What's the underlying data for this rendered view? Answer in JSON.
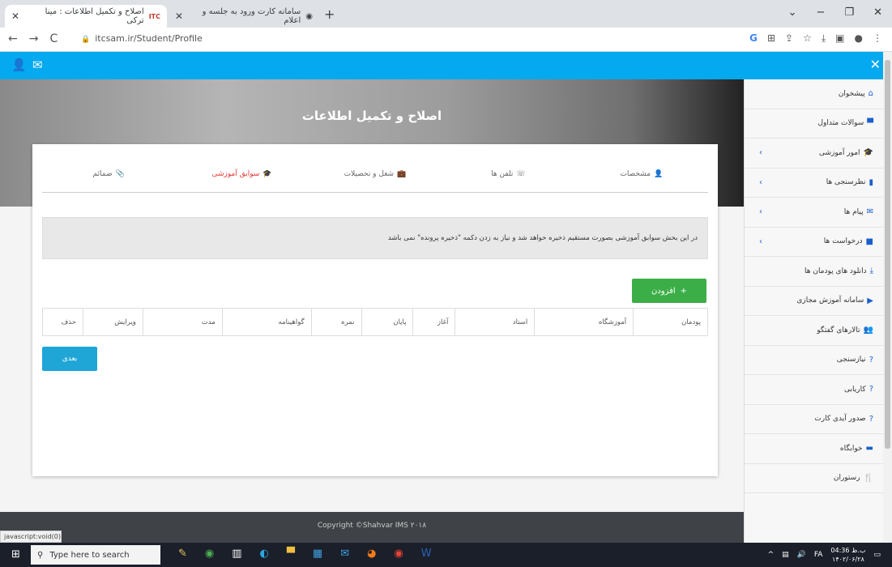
{
  "browser": {
    "tabs": [
      {
        "title": "اصلاح و تکمیل اطلاعات : مینا ترکی",
        "favicon": "ITC"
      },
      {
        "title": "سامانه کارت ورود به جلسه و اعلام"
      }
    ],
    "url": "itcsam.ir/Student/Profile"
  },
  "hero": {
    "title": "اصلاح و تکمیل اطلاعات"
  },
  "steps": [
    {
      "label": "مشخصات",
      "icon": "user-icon"
    },
    {
      "label": "تلفن ها",
      "icon": "phone-icon"
    },
    {
      "label": "شغل و تحصیلات",
      "icon": "briefcase-icon"
    },
    {
      "label": "سوابق آموزشی",
      "icon": "graduation-cap-icon",
      "active": true
    },
    {
      "label": "ضمائم",
      "icon": "paperclip-icon"
    }
  ],
  "notice": "در این بخش سوابق آموزشی بصورت مستقیم ذخیره خواهد شد و نیاز به زدن دکمه \"ذخیره پرونده\" نمی باشد",
  "add_button": "افزودن",
  "table_headers": [
    "پودمان",
    "آموزشگاه",
    "استاد",
    "آغاز",
    "پایان",
    "نمره",
    "گواهینامه",
    "مدت",
    "ویرایش",
    "حذف"
  ],
  "next_button": "بعدی",
  "footer": "Copyright ©Shahvar IMS ۲۰۱۸",
  "sidebar": [
    {
      "label": "پیشخوان",
      "icon": "home-icon"
    },
    {
      "label": "سوالات متداول",
      "icon": "chat-icon"
    },
    {
      "label": "امور آموزشی",
      "icon": "graduation-cap-icon",
      "chevron": true
    },
    {
      "label": "نظرسنجی ها",
      "icon": "bar-chart-icon",
      "chevron": true
    },
    {
      "label": "پیام ها",
      "icon": "envelope-icon",
      "chevron": true
    },
    {
      "label": "درخواست ها",
      "icon": "comment-icon",
      "chevron": true
    },
    {
      "label": "دانلود های پودمان ها",
      "icon": "download-icon"
    },
    {
      "label": "سامانه آموزش مجازی",
      "icon": "play-circle-icon"
    },
    {
      "label": "تالارهای گفتگو",
      "icon": "users-icon"
    },
    {
      "label": "نیازسنجی",
      "icon": "question-circle-icon"
    },
    {
      "label": "کاریابی",
      "icon": "question-circle-icon"
    },
    {
      "label": "صدور آیدی کارت",
      "icon": "question-circle-icon"
    },
    {
      "label": "خوابگاه",
      "icon": "bed-icon"
    },
    {
      "label": "رستوران",
      "icon": "utensils-icon"
    }
  ],
  "statusbar": "javascript:void(0)",
  "taskbar": {
    "search_placeholder": "Type here to search",
    "time": "04:36 ب.ظ",
    "date": "۱۴۰۲/۰۶/۲۸",
    "lang": "FA"
  }
}
